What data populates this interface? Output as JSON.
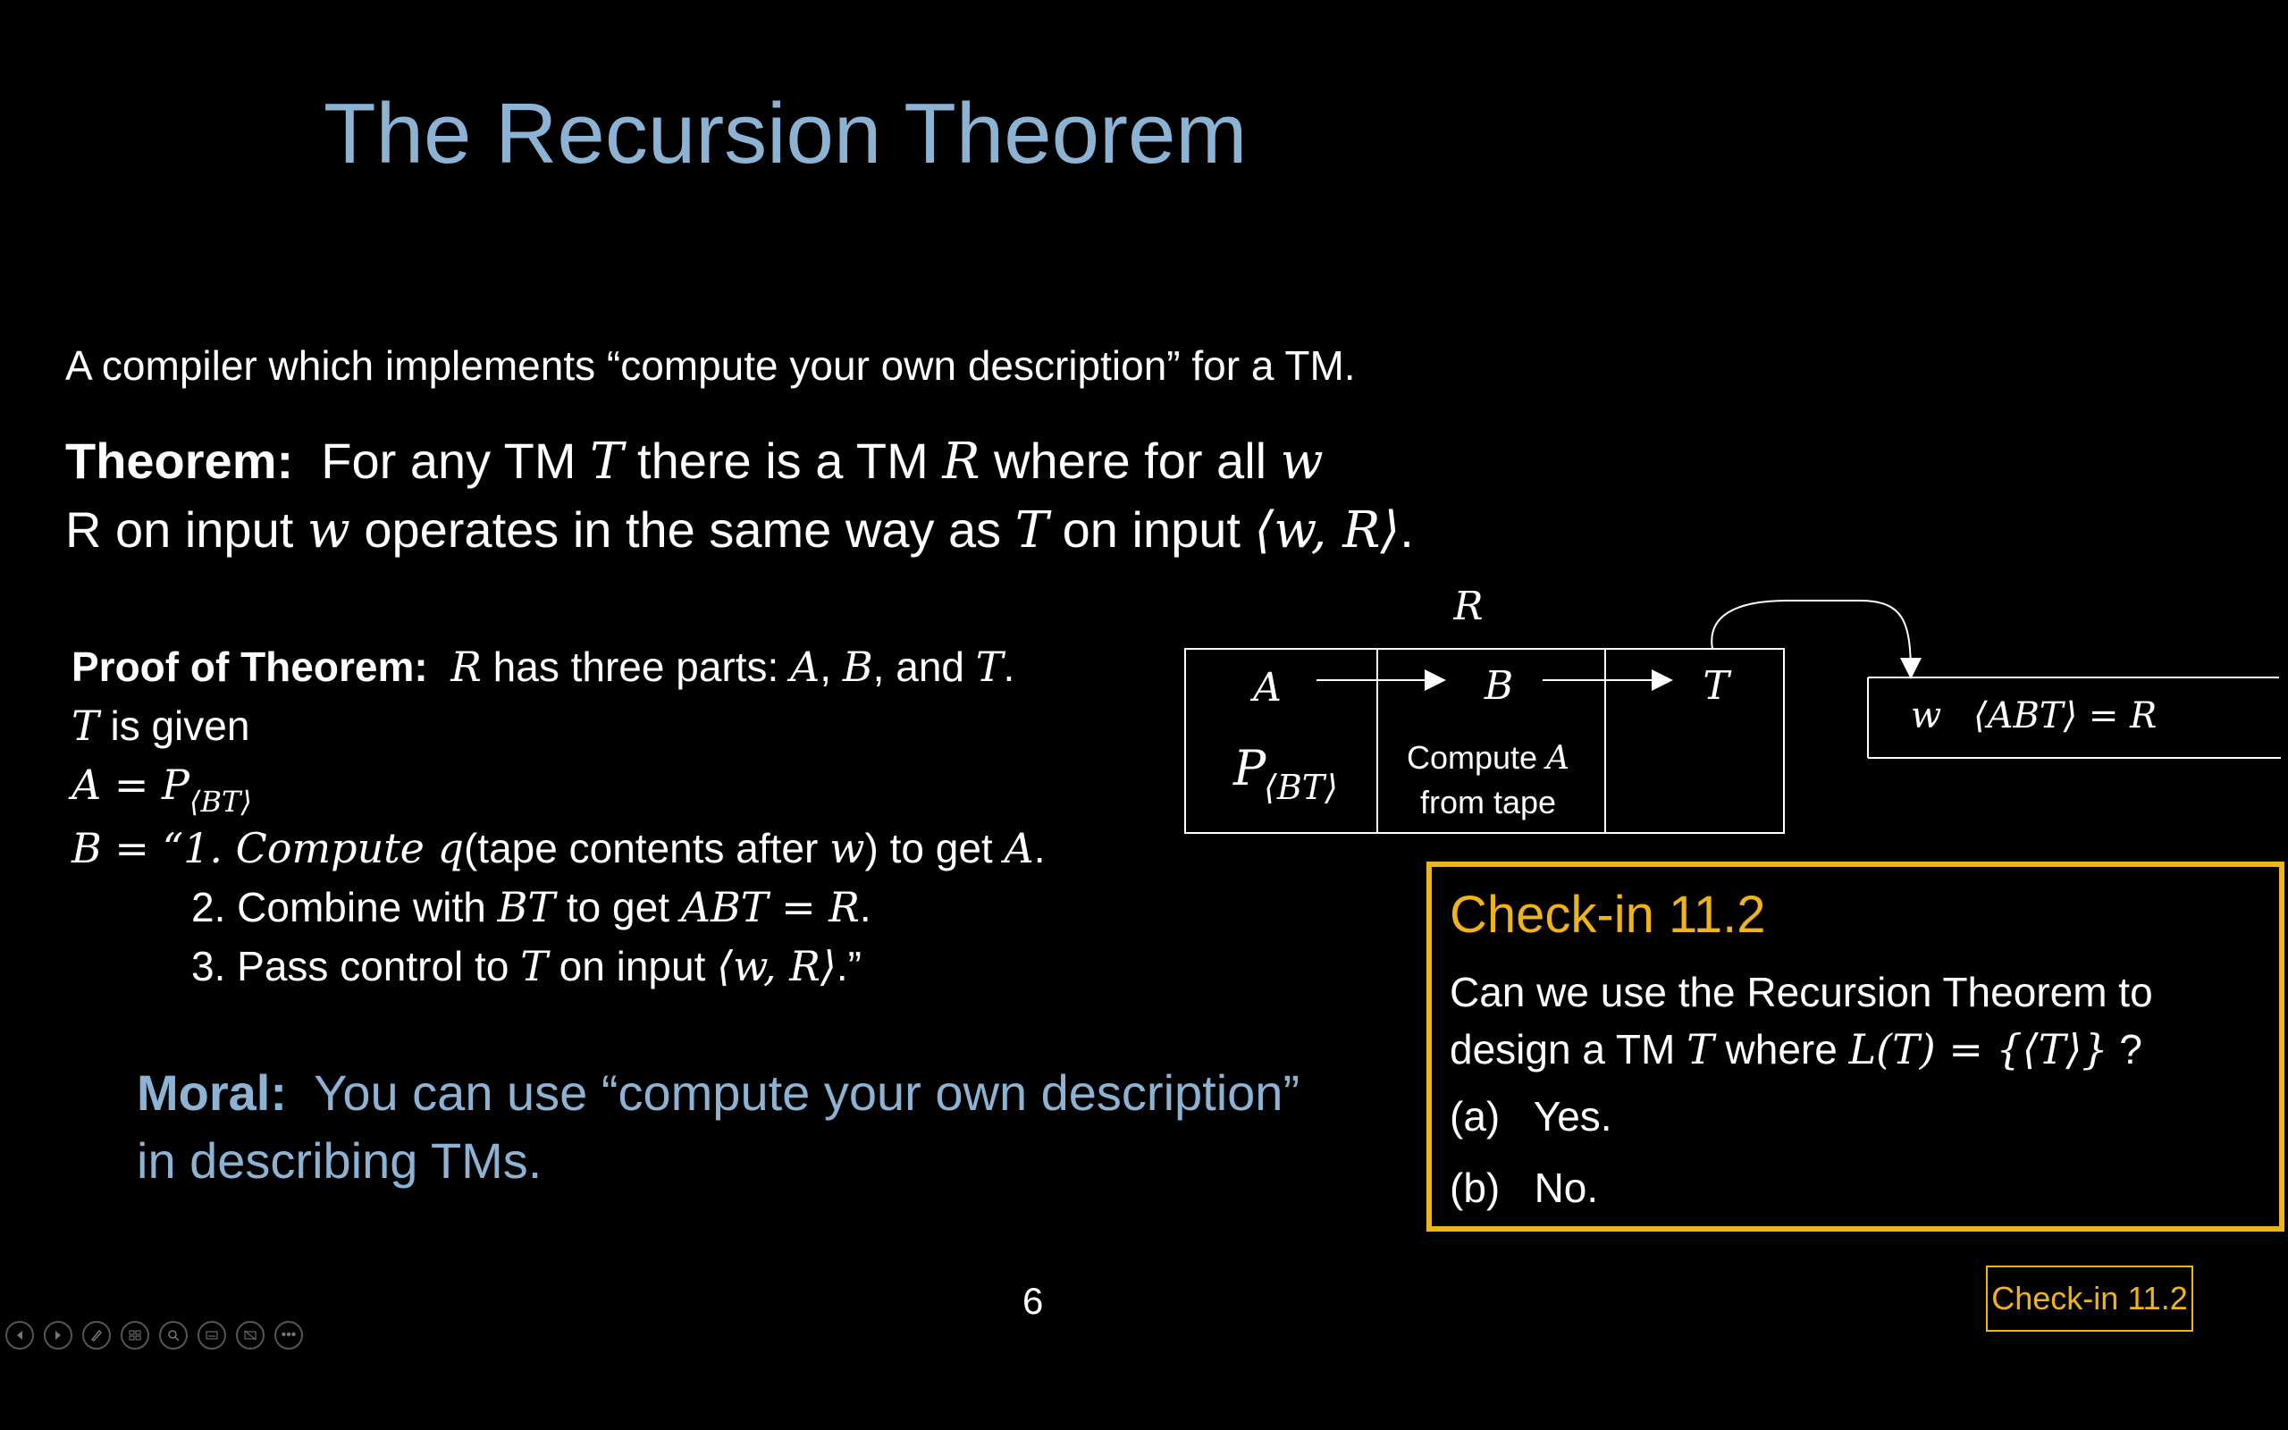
{
  "slide": {
    "title": "The Recursion Theorem",
    "intro": "A compiler which implements “compute your own description” for a TM.",
    "theorem": {
      "label": "Theorem:",
      "l1a": "For any TM ",
      "l1T": "T",
      "l1b": " there is a TM ",
      "l1R": "R",
      "l1c": " where for all ",
      "l1w": "w",
      "l2a": "R on input ",
      "l2w": "w",
      "l2b": " operates in the same way as ",
      "l2T": "T",
      "l2c": " on input ",
      "l2m": "⟨w, R⟩",
      "l2d": "."
    },
    "proof": {
      "label": "Proof of Theorem:",
      "l1R": "R",
      "l1a": " has three parts:  ",
      "l1A": "A",
      "l1c1": ", ",
      "l1B": "B",
      "l1c2": ", and ",
      "l1T": "T",
      "l1d": ".",
      "l2T": "T",
      "l2a": " is given",
      "l3a": "A =  P",
      "l3sub": "⟨BT⟩",
      "l4a": "B =  “1.  Compute ",
      "l4q": "q",
      "l4b": "(tape contents after ",
      "l4w": "w",
      "l4c": ") to get ",
      "l4A": "A",
      "l4d": ".",
      "l5a": "2.  Combine with ",
      "l5BT": "BT",
      "l5b": " to get ",
      "l5m": "ABT = R",
      "l5c": ".",
      "l6a": "3.  Pass control to ",
      "l6T": "T",
      "l6b": " on input ",
      "l6m": "⟨w, R⟩",
      "l6c": ".”"
    },
    "moral": {
      "label": "Moral:",
      "l1": "You can use “compute your own description”",
      "l2": "in describing TMs."
    },
    "diagram": {
      "top_label": "R",
      "box_a": "A",
      "box_b": "B",
      "box_t": "T",
      "p_main": "P",
      "p_sub": "⟨BT⟩",
      "compute_l1": "Compute ",
      "compute_A": "A",
      "compute_l2": "from tape",
      "tape_w": "w",
      "tape_eq": "⟨ABT⟩ = R"
    },
    "checkin": {
      "title": "Check-in 11.2",
      "q1": "Can we use the Recursion Theorem to",
      "q2a": "design a TM ",
      "q2T": "T",
      "q2b": " where ",
      "q2m": "L(T) = {⟨T⟩}",
      "q2c": " ?",
      "opt_a_key": "(a)",
      "opt_a": "Yes.",
      "opt_b_key": "(b)",
      "opt_b": "No."
    },
    "page_number": "6",
    "badge": "Check-in 11.2"
  },
  "toolbar": {
    "icons": [
      "previous-icon",
      "next-icon",
      "pen-icon",
      "slides-grid-icon",
      "zoom-icon",
      "subtitles-icon",
      "hide-screen-icon",
      "more-icon"
    ],
    "more_label": "•••"
  },
  "colors": {
    "title": "#8db3d4",
    "accent": "#f0b41b",
    "background": "#000000"
  }
}
